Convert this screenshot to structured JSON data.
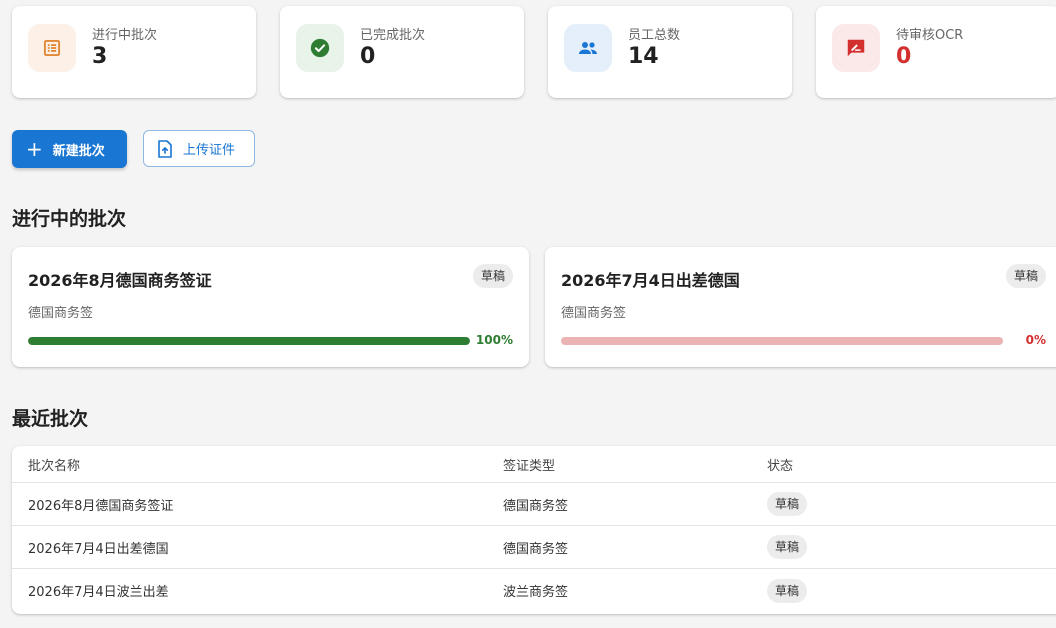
{
  "stats": [
    {
      "label": "进行中批次",
      "value": "3",
      "icon": "list-alt-icon",
      "bg": "#fdf0e6",
      "fg": "#e07a1f"
    },
    {
      "label": "已完成批次",
      "value": "0",
      "icon": "check-circle-icon",
      "bg": "#e8f3ea",
      "fg": "#2e7d32"
    },
    {
      "label": "员工总数",
      "value": "14",
      "icon": "people-icon",
      "bg": "#e4effb",
      "fg": "#1976d2"
    },
    {
      "label": "待审核OCR",
      "value": "0",
      "icon": "rate-review-icon",
      "bg": "#fbe8e8",
      "fg": "#d32f2f"
    }
  ],
  "actions": {
    "new_batch": "新建批次",
    "upload": "上传证件"
  },
  "active_section": {
    "title": "进行中的批次",
    "cards": [
      {
        "name": "2026年8月德国商务签证",
        "status": "草稿",
        "type": "德国商务签",
        "progress": 100,
        "progress_label": "100%",
        "color": "#2e7d32",
        "track": "#e0e0e0"
      },
      {
        "name": "2026年7月4日出差德国",
        "status": "草稿",
        "type": "德国商务签",
        "progress": 0,
        "progress_label": "0%",
        "color": "#d32f2f",
        "track": "#ebb3b3"
      }
    ]
  },
  "recent_section": {
    "title": "最近批次",
    "columns": [
      "批次名称",
      "签证类型",
      "状态"
    ],
    "rows": [
      {
        "name": "2026年8月德国商务签证",
        "type": "德国商务签",
        "status": "草稿"
      },
      {
        "name": "2026年7月4日出差德国",
        "type": "德国商务签",
        "status": "草稿"
      },
      {
        "name": "2026年7月4日波兰出差",
        "type": "波兰商务签",
        "status": "草稿"
      }
    ]
  }
}
